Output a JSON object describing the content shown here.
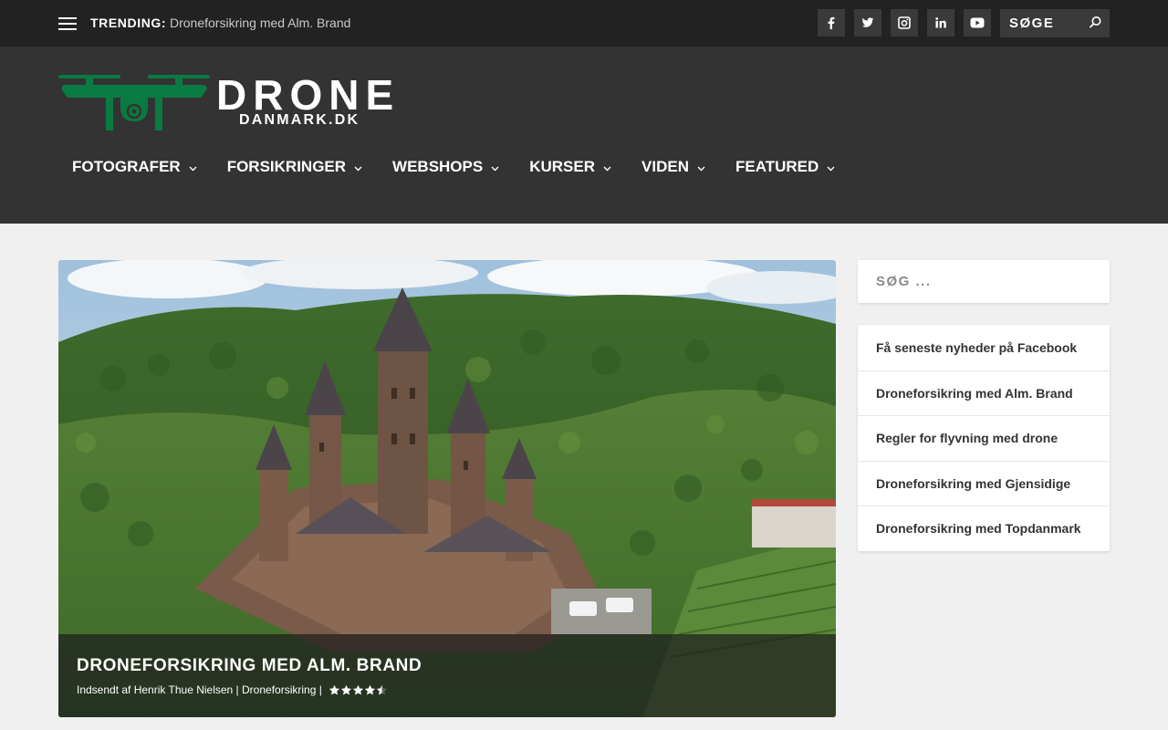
{
  "topbar": {
    "trending_label": "TRENDING:",
    "trending_link": "Droneforsikring med Alm. Brand",
    "social": [
      "facebook-icon",
      "twitter-icon",
      "instagram-icon",
      "linkedin-icon",
      "youtube-icon"
    ],
    "search_placeholder": "SØGE"
  },
  "logo": {
    "word": "DRONE",
    "sub": "DANMARK.DK",
    "accent": "#0a7a43"
  },
  "nav": {
    "items": [
      {
        "label": "FOTOGRAFER"
      },
      {
        "label": "FORSIKRINGER"
      },
      {
        "label": "WEBSHOPS"
      },
      {
        "label": "KURSER"
      },
      {
        "label": "VIDEN"
      },
      {
        "label": "FEATURED"
      }
    ]
  },
  "featured": {
    "title": "DRONEFORSIKRING MED ALM. BRAND",
    "meta_prefix": "Indsendt af ",
    "author": "Henrik Thue Nielsen",
    "sep": " | ",
    "category": "Droneforsikring",
    "sep2": " | ",
    "rating": 4.5,
    "rating_max": 5
  },
  "sidebar": {
    "search_placeholder": "SØG ...",
    "items": [
      {
        "label": "Få seneste nyheder på Facebook"
      },
      {
        "label": "Droneforsikring med Alm. Brand"
      },
      {
        "label": "Regler for flyvning med drone"
      },
      {
        "label": "Droneforsikring med Gjensidige"
      },
      {
        "label": "Droneforsikring med Topdanmark"
      }
    ]
  },
  "colors": {
    "topbar": "#222222",
    "header": "#333333",
    "body": "#f0f0f0",
    "social_bg": "#3a3a3a"
  }
}
